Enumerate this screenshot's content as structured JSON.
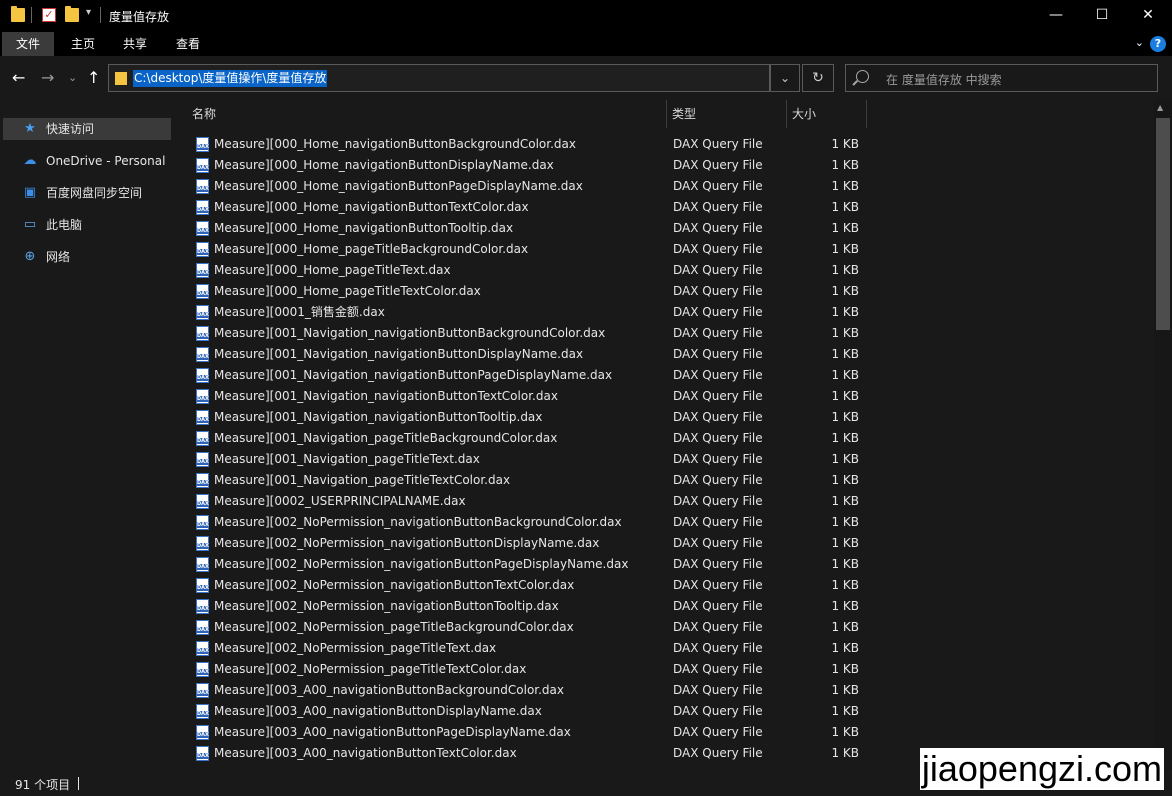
{
  "window": {
    "title": "度量值存放",
    "minimize": "—",
    "maximize": "☐",
    "close": "✕"
  },
  "ribbon": {
    "tabs": [
      "文件",
      "主页",
      "共享",
      "查看"
    ],
    "help": "?",
    "collapse": "⌄"
  },
  "nav": {
    "back": "←",
    "forward": "→",
    "recent": "⌄",
    "up": "↑"
  },
  "address": {
    "path": "C:\\desktop\\度量值操作\\度量值存放",
    "dropdown": "⌄",
    "refresh": "↻"
  },
  "search": {
    "placeholder": "在 度量值存放 中搜索"
  },
  "sidebar": {
    "items": [
      {
        "label": "快速访问",
        "icon": "★"
      },
      {
        "label": "OneDrive - Personal",
        "icon": "☁"
      },
      {
        "label": "百度网盘同步空间",
        "icon": "▣"
      },
      {
        "label": "此电脑",
        "icon": "▭"
      },
      {
        "label": "网络",
        "icon": "⊕"
      }
    ]
  },
  "columns": {
    "name": "名称",
    "type": "类型",
    "size": "大小"
  },
  "files": [
    {
      "name": "Measure][000_Home_navigationButtonBackgroundColor.dax",
      "type": "DAX Query File",
      "size": "1 KB"
    },
    {
      "name": "Measure][000_Home_navigationButtonDisplayName.dax",
      "type": "DAX Query File",
      "size": "1 KB"
    },
    {
      "name": "Measure][000_Home_navigationButtonPageDisplayName.dax",
      "type": "DAX Query File",
      "size": "1 KB"
    },
    {
      "name": "Measure][000_Home_navigationButtonTextColor.dax",
      "type": "DAX Query File",
      "size": "1 KB"
    },
    {
      "name": "Measure][000_Home_navigationButtonTooltip.dax",
      "type": "DAX Query File",
      "size": "1 KB"
    },
    {
      "name": "Measure][000_Home_pageTitleBackgroundColor.dax",
      "type": "DAX Query File",
      "size": "1 KB"
    },
    {
      "name": "Measure][000_Home_pageTitleText.dax",
      "type": "DAX Query File",
      "size": "1 KB"
    },
    {
      "name": "Measure][000_Home_pageTitleTextColor.dax",
      "type": "DAX Query File",
      "size": "1 KB"
    },
    {
      "name": "Measure][0001_销售金额.dax",
      "type": "DAX Query File",
      "size": "1 KB"
    },
    {
      "name": "Measure][001_Navigation_navigationButtonBackgroundColor.dax",
      "type": "DAX Query File",
      "size": "1 KB"
    },
    {
      "name": "Measure][001_Navigation_navigationButtonDisplayName.dax",
      "type": "DAX Query File",
      "size": "1 KB"
    },
    {
      "name": "Measure][001_Navigation_navigationButtonPageDisplayName.dax",
      "type": "DAX Query File",
      "size": "1 KB"
    },
    {
      "name": "Measure][001_Navigation_navigationButtonTextColor.dax",
      "type": "DAX Query File",
      "size": "1 KB"
    },
    {
      "name": "Measure][001_Navigation_navigationButtonTooltip.dax",
      "type": "DAX Query File",
      "size": "1 KB"
    },
    {
      "name": "Measure][001_Navigation_pageTitleBackgroundColor.dax",
      "type": "DAX Query File",
      "size": "1 KB"
    },
    {
      "name": "Measure][001_Navigation_pageTitleText.dax",
      "type": "DAX Query File",
      "size": "1 KB"
    },
    {
      "name": "Measure][001_Navigation_pageTitleTextColor.dax",
      "type": "DAX Query File",
      "size": "1 KB"
    },
    {
      "name": "Measure][0002_USERPRINCIPALNAME.dax",
      "type": "DAX Query File",
      "size": "1 KB"
    },
    {
      "name": "Measure][002_NoPermission_navigationButtonBackgroundColor.dax",
      "type": "DAX Query File",
      "size": "1 KB"
    },
    {
      "name": "Measure][002_NoPermission_navigationButtonDisplayName.dax",
      "type": "DAX Query File",
      "size": "1 KB"
    },
    {
      "name": "Measure][002_NoPermission_navigationButtonPageDisplayName.dax",
      "type": "DAX Query File",
      "size": "1 KB"
    },
    {
      "name": "Measure][002_NoPermission_navigationButtonTextColor.dax",
      "type": "DAX Query File",
      "size": "1 KB"
    },
    {
      "name": "Measure][002_NoPermission_navigationButtonTooltip.dax",
      "type": "DAX Query File",
      "size": "1 KB"
    },
    {
      "name": "Measure][002_NoPermission_pageTitleBackgroundColor.dax",
      "type": "DAX Query File",
      "size": "1 KB"
    },
    {
      "name": "Measure][002_NoPermission_pageTitleText.dax",
      "type": "DAX Query File",
      "size": "1 KB"
    },
    {
      "name": "Measure][002_NoPermission_pageTitleTextColor.dax",
      "type": "DAX Query File",
      "size": "1 KB"
    },
    {
      "name": "Measure][003_A00_navigationButtonBackgroundColor.dax",
      "type": "DAX Query File",
      "size": "1 KB"
    },
    {
      "name": "Measure][003_A00_navigationButtonDisplayName.dax",
      "type": "DAX Query File",
      "size": "1 KB"
    },
    {
      "name": "Measure][003_A00_navigationButtonPageDisplayName.dax",
      "type": "DAX Query File",
      "size": "1 KB"
    },
    {
      "name": "Measure][003_A00_navigationButtonTextColor.dax",
      "type": "DAX Query File",
      "size": "1 KB"
    }
  ],
  "status": {
    "count": "91 个项目"
  },
  "watermark": "jiaopengzi.com",
  "colors": {
    "background": "#191919",
    "titlebar": "#000000",
    "selection": "#0a64c8",
    "folder": "#f5c542"
  }
}
